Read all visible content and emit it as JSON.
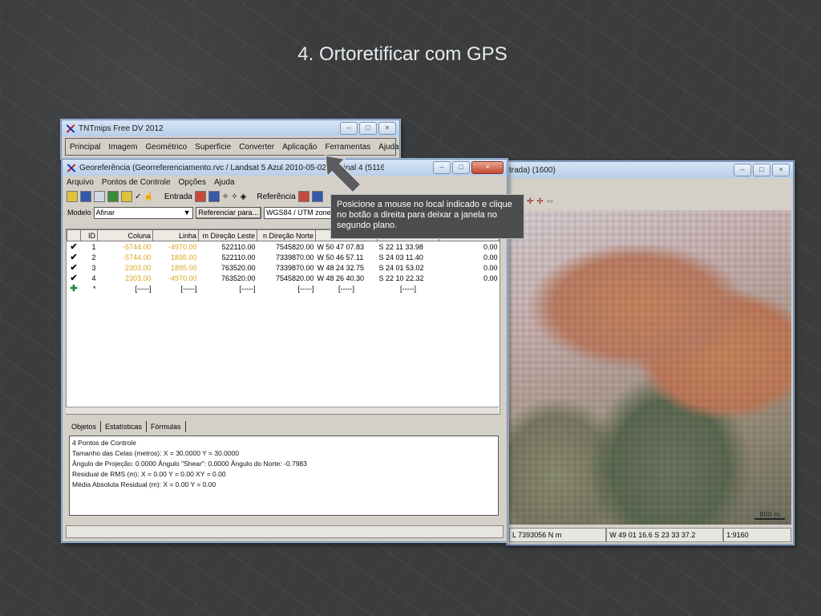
{
  "slide": {
    "title": "4. Ortoretificar com GPS"
  },
  "tnt_window": {
    "title": "TNTmips Free DV 2012",
    "menu": [
      "Principal",
      "Imagem",
      "Geométrico",
      "Superfície",
      "Converter",
      "Aplicação",
      "Ferramentas",
      "Ajuda"
    ]
  },
  "image_window": {
    "title": "trada) (1600)",
    "scale_bar": "800 m",
    "status": [
      "L 7393056 N m",
      "W 49 01 16.6  S 23 33 37.2",
      "1:9160"
    ]
  },
  "geo_window": {
    "title": "Georeferência (Georreferenciamento.rvc / Landsat 5 Azul 2010-05-02 Original 4 (5116)",
    "menu": [
      "Arquivo",
      "Pontos de Controle",
      "Opções",
      "Ajuda"
    ],
    "toolbar": {
      "entrada": "Entrada",
      "referencia": "Referência"
    },
    "model": {
      "label": "Modelo",
      "value": "Afinar",
      "button": "Referenciar para...",
      "projection": "WGS84 / UTM zone"
    },
    "columns": [
      "ID",
      "Coluna",
      "Linha",
      "m Direção Leste",
      "n Direção Norte",
      "",
      "",
      ""
    ],
    "rows": [
      {
        "id": "1",
        "coluna": "-5744.00",
        "linha": "-4970.00",
        "leste": "522110.00",
        "norte": "7545820.00",
        "lon": "W 50 47 07.83",
        "lat": "S 22 11 33.98",
        "res": "0.00"
      },
      {
        "id": "2",
        "coluna": "-5744.00",
        "linha": "1895.00",
        "leste": "522110.00",
        "norte": "7339870.00",
        "lon": "W 50 46 57.11",
        "lat": "S 24 03 11.40",
        "res": "0.00"
      },
      {
        "id": "3",
        "coluna": "2303.00",
        "linha": "1895.00",
        "leste": "763520.00",
        "norte": "7339870.00",
        "lon": "W 48 24 32.75",
        "lat": "S 24 01 53.02",
        "res": "0.00"
      },
      {
        "id": "4",
        "coluna": "2303.00",
        "linha": "-4970.00",
        "leste": "763520.00",
        "norte": "7545820.00",
        "lon": "W 48 26 40.30",
        "lat": "S 22 10 22.32",
        "res": "0.00"
      }
    ],
    "new_row": {
      "id": "*",
      "placeholder": "[-----]"
    },
    "tabs": [
      "Objetos",
      "Estatísticas",
      "Fórmulas"
    ],
    "info_lines": [
      "4 Pontos de Controle",
      "Tamanho das Celas (metros):  X = 30.0000  Y = 30.0000",
      "Ângulo de Projeção: 0.0000  Ângulo \"Shear\": 0.0000  Ângulo do Norte: -0.7983",
      "Residual de RMS (m):  X = 0.00  Y = 0.00  XY = 0.00",
      "Média Absoluta Residual (m):  X = 0.00  Y = 0.00"
    ]
  },
  "callout": {
    "text": "Posicione a mouse no local indicado e clique no botão a direita para deixar a janela no segundo plano."
  },
  "colors": {
    "background": "#3b3d3e",
    "title_text": "#e9ecef",
    "orange_value": "#d9a81f",
    "callout_bg": "#4b4d4f"
  }
}
